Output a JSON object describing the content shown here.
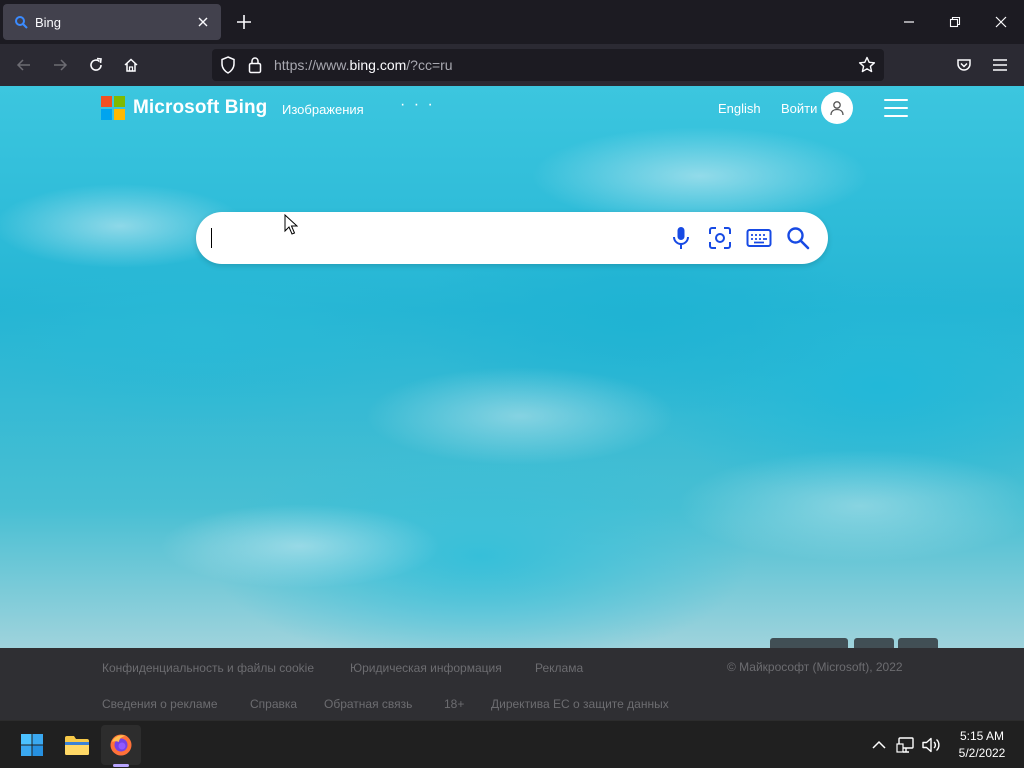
{
  "browser": {
    "tab": {
      "title": "Bing"
    },
    "url": {
      "prefix": "https://www.",
      "domain": "bing.com",
      "suffix": "/?cc=ru"
    }
  },
  "header": {
    "logo_text": "Microsoft Bing",
    "images_link": "Изображения",
    "more": "· · ·",
    "language_link": "English",
    "signin_link": "Войти"
  },
  "search": {
    "value": "",
    "placeholder": ""
  },
  "footer": {
    "row1": [
      "Конфиденциальность и файлы cookie",
      "Юридическая информация",
      "Реклама"
    ],
    "copyright": "© Майкрософт (Microsoft), 2022",
    "row2": [
      "Сведения о рекламе",
      "Справка",
      "Обратная связь",
      "18+",
      "Директива ЕС о защите данных"
    ]
  },
  "taskbar": {
    "time": "5:15 AM",
    "date": "5/2/2022"
  },
  "colors": {
    "ms_red": "#f25022",
    "ms_green": "#7fba00",
    "ms_blue": "#00a4ef",
    "ms_yellow": "#ffb900",
    "search_icon_blue": "#174ae4"
  },
  "icons": [
    "bing-favicon-icon",
    "close-icon",
    "plus-icon",
    "minimize-icon",
    "restore-icon",
    "close-window-icon",
    "back-icon",
    "forward-icon",
    "reload-icon",
    "home-icon",
    "shield-icon",
    "lock-icon",
    "star-icon",
    "pocket-icon",
    "menu-icon",
    "user-icon",
    "hamburger-icon",
    "microphone-icon",
    "visual-search-icon",
    "keyboard-icon",
    "search-icon",
    "windows-start-icon",
    "file-explorer-icon",
    "firefox-icon",
    "chevron-up-icon",
    "network-icon",
    "volume-icon"
  ]
}
